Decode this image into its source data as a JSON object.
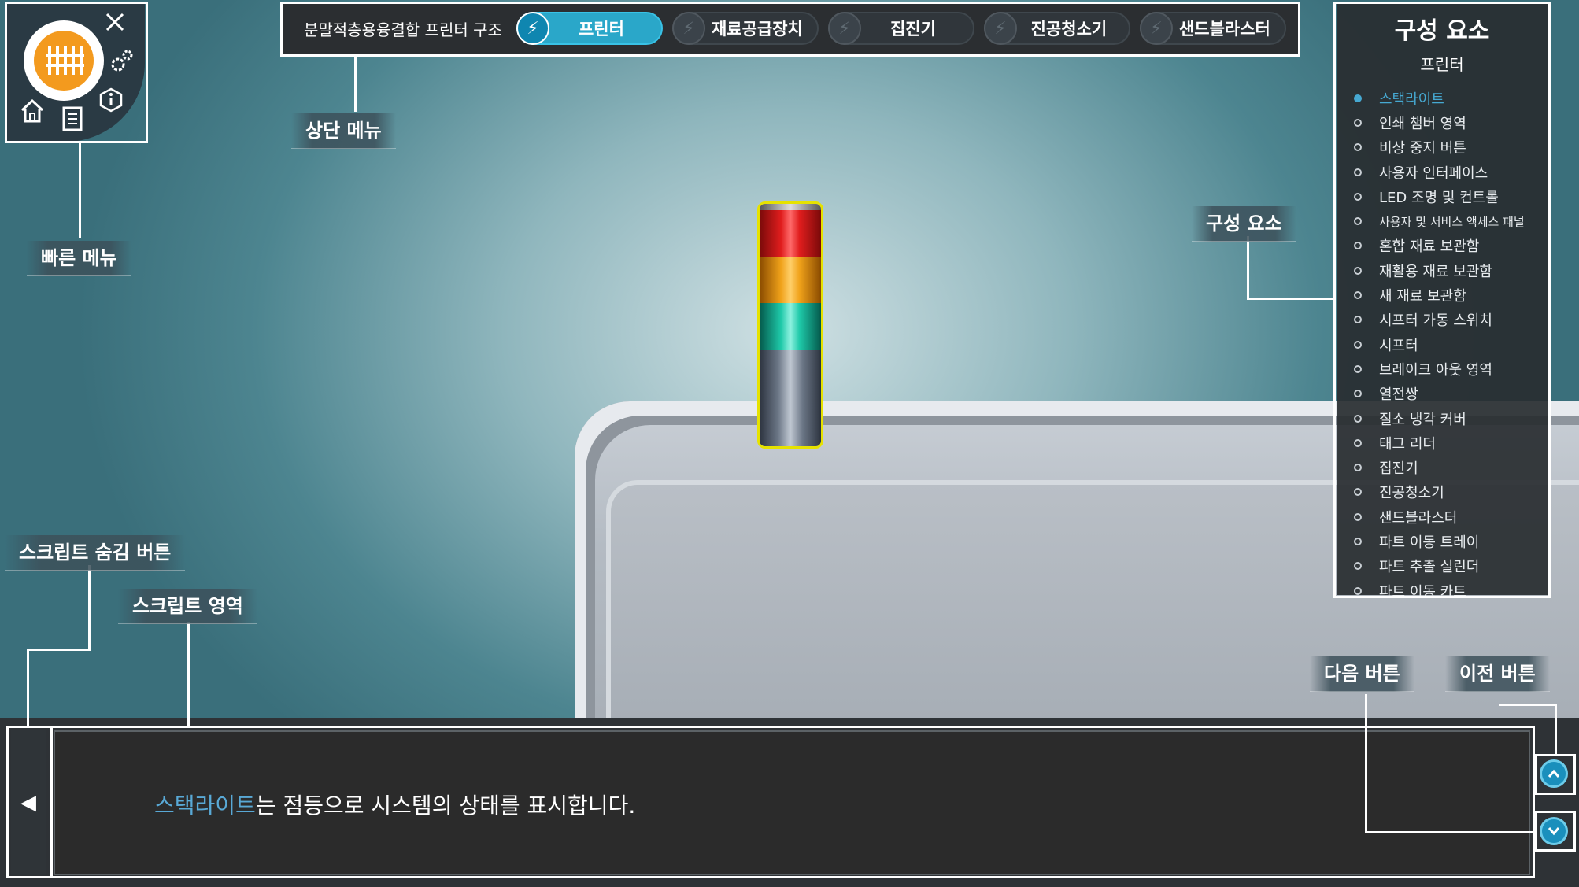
{
  "quick_menu": {
    "logo_icon": "orange-emblem-logo",
    "icons": [
      "close-icon",
      "gear-icon",
      "home-icon",
      "document-icon",
      "info-icon"
    ]
  },
  "top_menu": {
    "title": "분말적층용융결합 프린터 구조",
    "tabs": [
      {
        "label": "프린터",
        "active": true
      },
      {
        "label": "재료공급장치",
        "active": false
      },
      {
        "label": "집진기",
        "active": false
      },
      {
        "label": "진공청소기",
        "active": false
      },
      {
        "label": "샌드블라스터",
        "active": false
      }
    ]
  },
  "components": {
    "title": "구성 요소",
    "subtitle": "프린터",
    "items": [
      {
        "label": "스택라이트",
        "active": true
      },
      {
        "label": "인쇄 챔버 영역"
      },
      {
        "label": "비상 중지 버튼"
      },
      {
        "label": "사용자 인터페이스"
      },
      {
        "label": "LED 조명 및 컨트롤"
      },
      {
        "label": "사용자 및 서비스 액세스 패널"
      },
      {
        "label": "혼합 재료 보관함"
      },
      {
        "label": "재활용 재료 보관함"
      },
      {
        "label": "새 재료 보관함"
      },
      {
        "label": "시프터 가동 스위치"
      },
      {
        "label": "시프터"
      },
      {
        "label": "브레이크 아웃 영역"
      },
      {
        "label": "열전쌍"
      },
      {
        "label": "질소 냉각 커버"
      },
      {
        "label": "태그 리더"
      },
      {
        "label": "집진기"
      },
      {
        "label": "진공청소기"
      },
      {
        "label": "샌드블라스터"
      },
      {
        "label": "파트 이동 트레이"
      },
      {
        "label": "파트 추출 실린더"
      },
      {
        "label": "파트 이동 카트"
      }
    ]
  },
  "callouts": {
    "top_menu": "상단 메뉴",
    "quick_menu": "빠른 메뉴",
    "components": "구성 요소",
    "hide_script": "스크립트 숨김 버튼",
    "script_area": "스크립트 영역",
    "next_button": "다음 버튼",
    "prev_button": "이전 버튼"
  },
  "script": {
    "highlight": "스택라이트",
    "text": "는 점등으로 시스템의 상태를 표시합니다.",
    "hide_icon": "◀",
    "up_icon": "chevron-up-icon",
    "down_icon": "chevron-down-icon"
  },
  "colors": {
    "accent": "#2aa7c9",
    "highlight_text": "#59a9d6",
    "stack_red": "#e01d1d",
    "stack_amber": "#f0a21a",
    "stack_green": "#1fc9a9",
    "outline_yellow": "#e6e200"
  }
}
